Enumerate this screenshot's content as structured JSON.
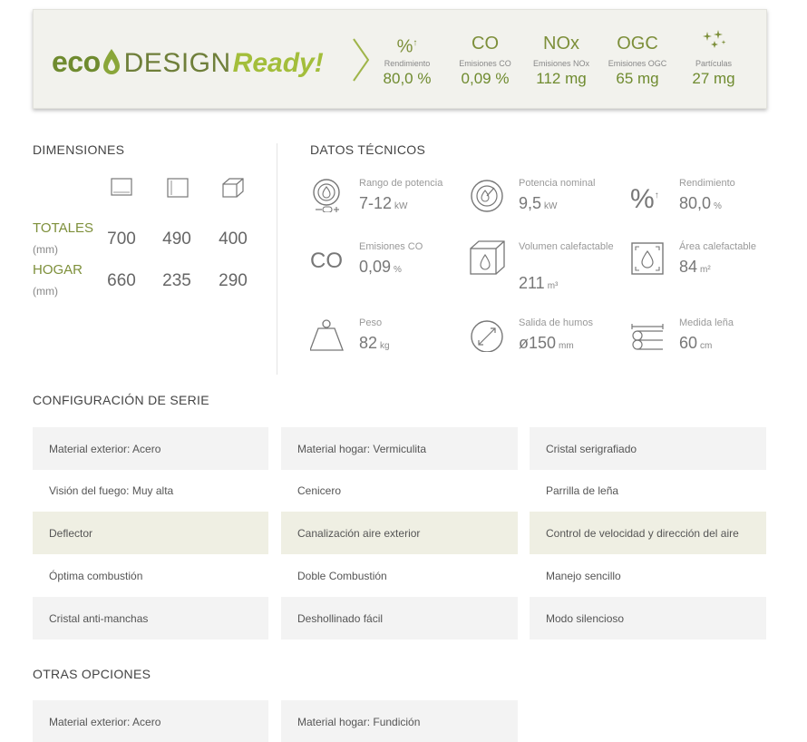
{
  "eco_banner": {
    "logo_eco": "eco",
    "logo_design": "DESIGN",
    "logo_ready": "Ready!",
    "metrics": [
      {
        "icon": "percent-icon",
        "symbol": "%",
        "label": "Rendimiento",
        "value": "80,0 %"
      },
      {
        "icon": "co-text-icon",
        "symbol": "CO",
        "label": "Emisiones CO",
        "value": "0,09 %"
      },
      {
        "icon": "nox-text-icon",
        "symbol": "NOx",
        "label": "Emisiones NOx",
        "value": "112 mg"
      },
      {
        "icon": "ogc-text-icon",
        "symbol": "OGC",
        "label": "Emisiones OGC",
        "value": "65 mg"
      },
      {
        "icon": "particles-icon",
        "symbol": "",
        "label": "Partículas",
        "value": "27 mg"
      }
    ]
  },
  "dimensions": {
    "title": "DIMENSIONES",
    "column_icons": [
      "width-icon",
      "height-icon",
      "depth-icon"
    ],
    "rows": [
      {
        "label": "TOTALES",
        "unit": "(mm)",
        "values": [
          "700",
          "490",
          "400"
        ]
      },
      {
        "label": "HOGAR",
        "unit": "(mm)",
        "values": [
          "660",
          "235",
          "290"
        ]
      }
    ]
  },
  "tech": {
    "title": "DATOS TÉCNICOS",
    "items": [
      {
        "icon": "power-range-icon",
        "label": "Rango de potencia",
        "value": "7-12",
        "unit": "kW"
      },
      {
        "icon": "nominal-power-icon",
        "label": "Potencia nominal",
        "value": "9,5",
        "unit": "kW"
      },
      {
        "icon": "efficiency-icon",
        "label": "Rendimiento",
        "value": "80,0",
        "unit": "%"
      },
      {
        "icon": "co-icon",
        "label": "Emisiones CO",
        "value": "0,09",
        "unit": "%"
      },
      {
        "icon": "heating-volume-icon",
        "label": "Volumen calefactable",
        "value": "211",
        "unit": "m³"
      },
      {
        "icon": "heating-area-icon",
        "label": "Área calefactable",
        "value": "84",
        "unit": "m²"
      },
      {
        "icon": "weight-icon",
        "label": "Peso",
        "value": "82",
        "unit": "kg"
      },
      {
        "icon": "flue-outlet-icon",
        "label": "Salida de humos",
        "value": "ø150",
        "unit": "mm"
      },
      {
        "icon": "log-length-icon",
        "label": "Medida leña",
        "value": "60",
        "unit": "cm"
      }
    ]
  },
  "config": {
    "title": "CONFIGURACIÓN DE SERIE",
    "items": [
      "Material exterior: Acero",
      "Material hogar: Vermiculita",
      "Cristal serigrafiado",
      "Visión del fuego: Muy alta",
      "Cenicero",
      "Parrilla de leña",
      "Deflector",
      "Canalización aire exterior",
      "Control de velocidad y dirección del aire",
      "Óptima combustión",
      "Doble Combustión",
      "Manejo sencillo",
      "Cristal anti-manchas",
      "Deshollinado fácil",
      "Modo silencioso"
    ]
  },
  "options": {
    "title": "OTRAS OPCIONES",
    "items": [
      "Material exterior: Acero",
      "Material hogar: Fundición"
    ]
  },
  "colors": {
    "accent_green": "#7d8f3a",
    "light_green": "#a3be3b",
    "row_green": "#efefe3",
    "row_grey": "#f3f3f3"
  }
}
